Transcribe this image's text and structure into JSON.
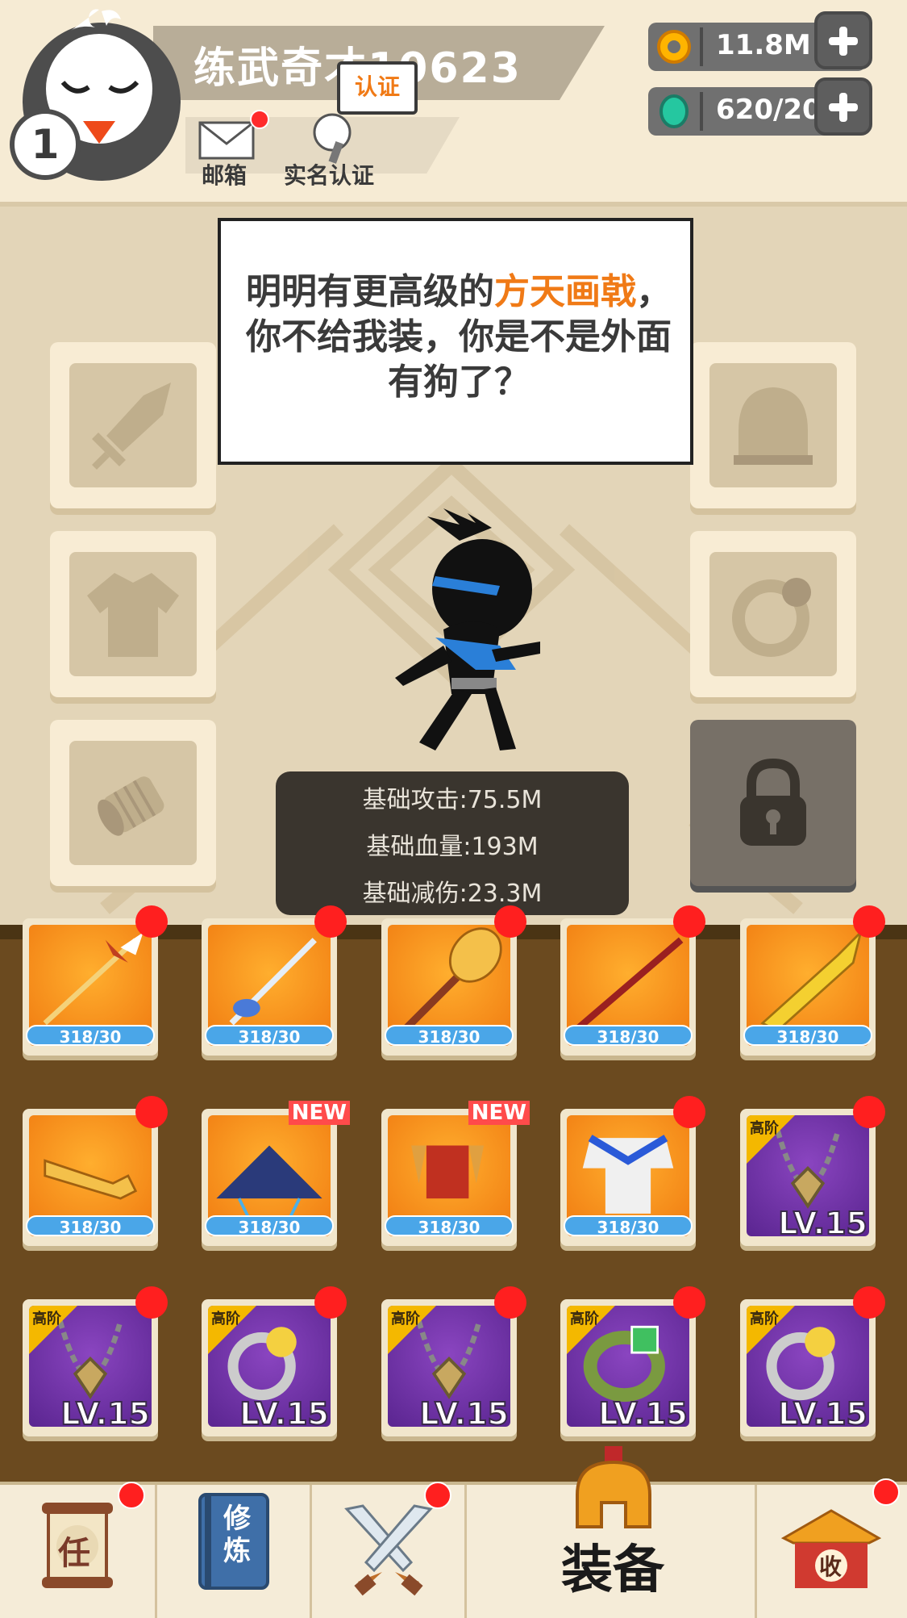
{
  "player": {
    "name": "练武奇才10623",
    "level": "1"
  },
  "header": {
    "mail_label": "邮箱",
    "verify_label": "实名认证",
    "verify_bubble": "认证"
  },
  "currencies": {
    "gold": "11.8M",
    "gems": "620/20"
  },
  "dialog": {
    "part1": "明明有更高级的",
    "highlight": "方天画戟",
    "part2": "，你不给我装，你是不是外面有狗了？"
  },
  "stats": {
    "attack": "基础攻击:75.5M",
    "hp": "基础血量:193M",
    "reduction": "基础减伤:23.3M"
  },
  "inventory": [
    {
      "kind": "spear-gold",
      "bg": "orange",
      "count": "318/30",
      "dot": true
    },
    {
      "kind": "spear-silver",
      "bg": "orange",
      "count": "318/30",
      "dot": true
    },
    {
      "kind": "mace",
      "bg": "orange",
      "count": "318/30",
      "dot": true
    },
    {
      "kind": "staff-red",
      "bg": "orange",
      "count": "318/30",
      "dot": true
    },
    {
      "kind": "broadsword",
      "bg": "orange",
      "count": "318/30",
      "dot": true
    },
    {
      "kind": "key",
      "bg": "orange",
      "count": "318/30",
      "dot": true
    },
    {
      "kind": "straw-hat",
      "bg": "orange",
      "count": "318/30",
      "badge": "NEW"
    },
    {
      "kind": "red-armor",
      "bg": "orange",
      "count": "318/30",
      "badge": "NEW"
    },
    {
      "kind": "white-robe",
      "bg": "orange",
      "count": "318/30",
      "dot": true
    },
    {
      "kind": "necklace",
      "bg": "purple",
      "tier": "高阶",
      "level": "LV.15",
      "dot": true
    },
    {
      "kind": "necklace",
      "bg": "purple",
      "tier": "高阶",
      "level": "LV.15",
      "dot": true
    },
    {
      "kind": "ring",
      "bg": "purple",
      "tier": "高阶",
      "level": "LV.15",
      "dot": true
    },
    {
      "kind": "necklace",
      "bg": "purple",
      "tier": "高阶",
      "level": "LV.15",
      "dot": true
    },
    {
      "kind": "jade-bracelet",
      "bg": "purple",
      "tier": "高阶",
      "level": "LV.15",
      "dot": true
    },
    {
      "kind": "ring",
      "bg": "purple",
      "tier": "高阶",
      "level": "LV.15",
      "dot": true
    }
  ],
  "nav": {
    "task_char": "任",
    "cultivate_char": "修炼",
    "equip_label": "装备",
    "collect_char": "收"
  },
  "colors": {
    "accent_orange": "#f07a16",
    "notify_red": "#ff1f1f",
    "purple_rare": "#6a2ca0"
  }
}
